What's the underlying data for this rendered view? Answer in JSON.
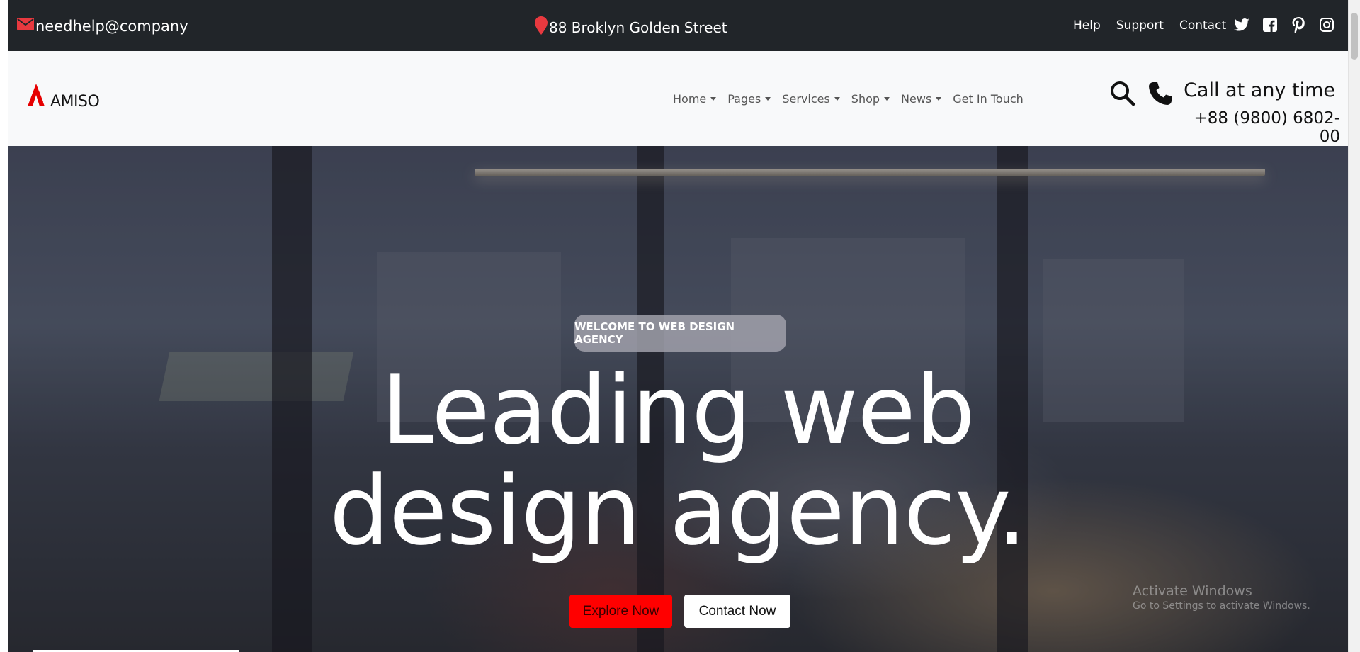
{
  "topbar": {
    "email": "needhelp@company",
    "email_icon": "envelope-icon",
    "address": "88 Broklyn Golden Street",
    "address_icon": "map-pin-icon",
    "links": [
      "Help",
      "Support",
      "Contact"
    ],
    "social_icons": [
      "twitter-icon",
      "facebook-icon",
      "pinterest-icon",
      "instagram-icon"
    ]
  },
  "navbar": {
    "logo_text": "AMISO",
    "menu": [
      "Home",
      "Pages",
      "Services",
      "Shop",
      "News",
      "Get In Touch"
    ],
    "call_title": "Call at any time",
    "call_number": "+88 (9800) 6802-00"
  },
  "hero": {
    "badge": "WELCOME TO WEB DESIGN AGENCY",
    "headline_line1": "Leading web",
    "headline_line2": "design agency.",
    "explore_button": "Explore Now",
    "contact_button": "Contact Now"
  },
  "watermark": {
    "title": "Activate Windows",
    "subtitle": "Go to Settings to activate Windows."
  },
  "colors": {
    "topbar_bg": "#212529",
    "navbar_bg": "#f8f9fa",
    "accent_red": "#ff0000",
    "icon_red": "#e8393f"
  }
}
